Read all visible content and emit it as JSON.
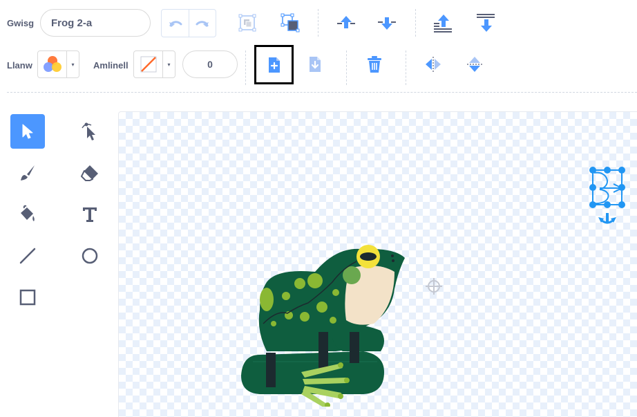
{
  "toolbar": {
    "costume_label": "Gwisg",
    "costume_name": "Frog 2-a",
    "fill_label": "Llanw",
    "outline_label": "Amlinell",
    "outline_width": "0",
    "dropdown_glyph": "▾"
  },
  "icons": {
    "undo": "undo-icon",
    "redo": "redo-icon",
    "group": "group-icon",
    "ungroup": "ungroup-icon",
    "forward": "forward-icon",
    "backward": "backward-icon",
    "front": "front-icon",
    "back": "back-icon",
    "copy": "copy-icon",
    "paste": "paste-icon",
    "delete": "delete-icon",
    "flip_h": "flip-horizontal-icon",
    "flip_v": "flip-vertical-icon"
  },
  "colors": {
    "accent": "#4c97ff",
    "text": "#575e75",
    "outline_none": "#ff6a2b",
    "frog_dark": "#0f5e3f",
    "frog_spot": "#8ab833",
    "frog_belly": "#f3e2c8",
    "frog_eye": "#f3e13a",
    "selection": "#2196f3"
  },
  "tools": {
    "active": "select"
  }
}
